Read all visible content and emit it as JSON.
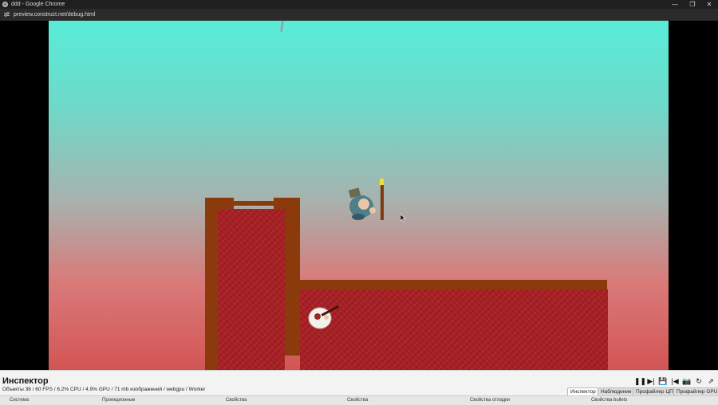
{
  "window": {
    "title": "ddd - Google Chrome",
    "minimize": "—",
    "maximize": "❐",
    "close": "✕"
  },
  "address": {
    "url": "preview.construct.net/debug.html"
  },
  "inspector": {
    "title": "Инспектор",
    "stats": "Объекты 36 / 60 FPS / 6.2% CPU / 4.9% GPU / 71 mb изображений / webgpu / Worker",
    "controls": {
      "pause": "❚❚",
      "step": "▶|",
      "save": "💾",
      "restart_first": "|◀",
      "screenshot": "📷",
      "reload": "↻",
      "popout": "⇗"
    },
    "tabs": [
      "Инспектор",
      "Наблюдение",
      "Профайлер ЦП",
      "Профайлер GPU"
    ],
    "active_tab": "Инспектор",
    "columns": [
      "Система",
      "Проекционные",
      "Свойства",
      "Свойства",
      "Свойства отладки",
      "Свойства bullets"
    ]
  }
}
